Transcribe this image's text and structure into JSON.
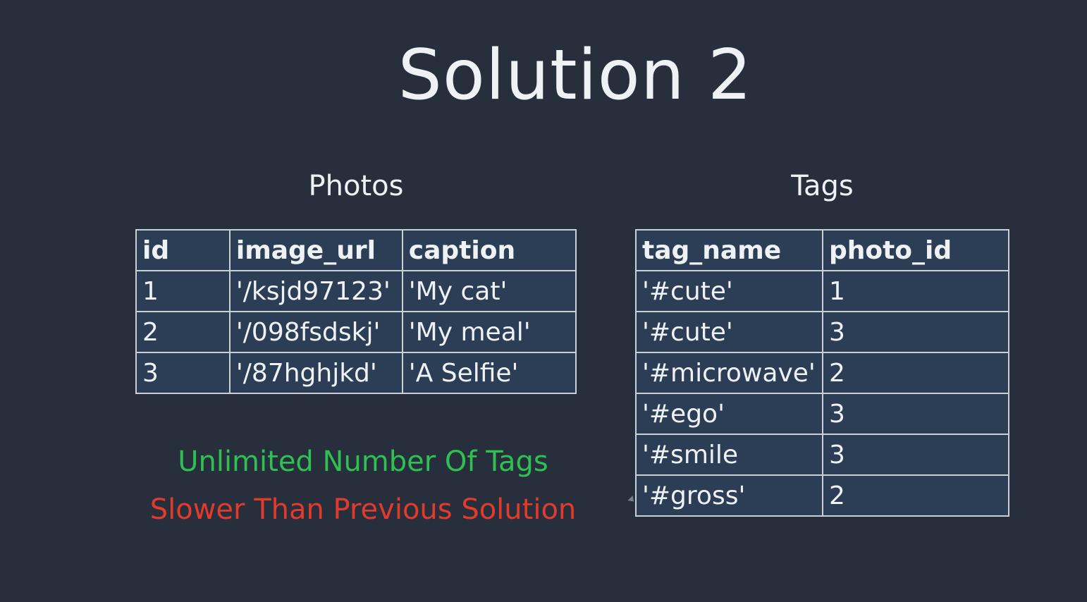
{
  "slide": {
    "title": "Solution 2"
  },
  "photos": {
    "heading": "Photos",
    "columns": [
      "id",
      "image_url",
      "caption"
    ],
    "rows": [
      [
        "1",
        "'/ksjd97123'",
        "'My cat'"
      ],
      [
        "2",
        "'/098fsdskj'",
        "'My meal'"
      ],
      [
        "3",
        "'/87hghjkd'",
        "'A Selfie'"
      ]
    ]
  },
  "tags": {
    "heading": "Tags",
    "columns": [
      "tag_name",
      "photo_id"
    ],
    "rows": [
      [
        "'#cute'",
        "1"
      ],
      [
        "'#cute'",
        "3"
      ],
      [
        "'#microwave'",
        "2"
      ],
      [
        "'#ego'",
        "3"
      ],
      [
        "'#smile",
        "3"
      ],
      [
        "'#gross'",
        "2"
      ]
    ]
  },
  "notes": {
    "pro": "Unlimited Number Of Tags",
    "con": "Slower Than Previous Solution"
  },
  "colors": {
    "background": "#262f3b",
    "table_fill": "#2c3e55",
    "pro": "#2fbf52",
    "con": "#e23a2c"
  }
}
